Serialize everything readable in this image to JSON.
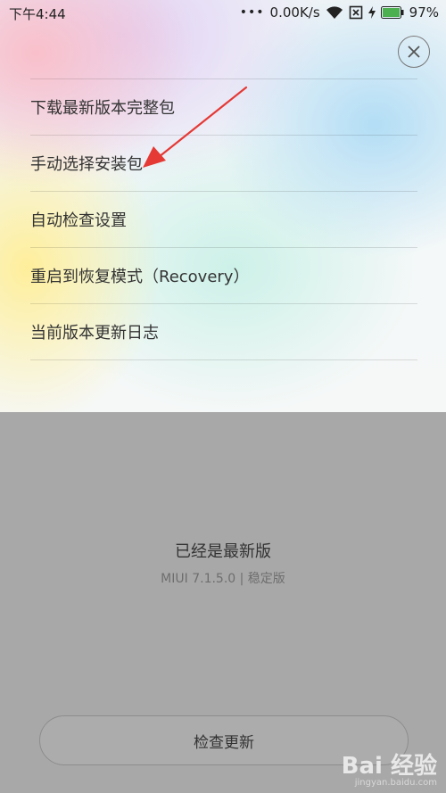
{
  "status_bar": {
    "time": "下午4:44",
    "network_speed": "0.00K/s",
    "battery": "97%"
  },
  "menu": {
    "items": [
      {
        "label": "下载最新版本完整包"
      },
      {
        "label": "手动选择安装包"
      },
      {
        "label": "自动检查设置"
      },
      {
        "label": "重启到恢复模式（Recovery）"
      },
      {
        "label": "当前版本更新日志"
      }
    ]
  },
  "version": {
    "status": "已经是最新版",
    "number": "MIUI 7.1.5.0 | 稳定版"
  },
  "check_update_label": "检查更新",
  "watermark": {
    "logo": "Bai 经验",
    "url": "jingyan.baidu.com"
  },
  "colors": {
    "annotation_arrow": "#e53935",
    "text": "#333333",
    "lower_panel": "#a8a8a8"
  }
}
